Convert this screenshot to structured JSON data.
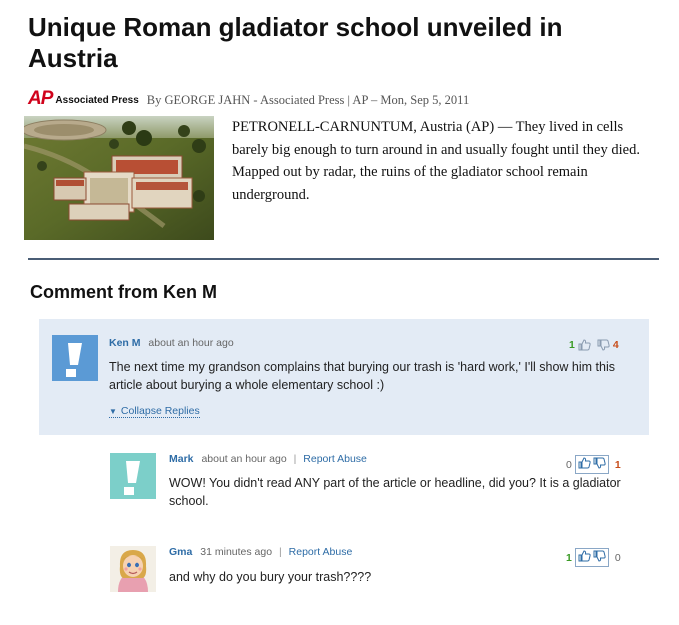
{
  "article": {
    "headline": "Unique Roman gladiator school unveiled in Austria",
    "logo_mark": "AP",
    "logo_text": "Associated Press",
    "byline": "By GEORGE JAHN - Associated Press | AP – Mon, Sep 5, 2011",
    "paragraph1": "PETRONELL-CARNUNTUM, Austria (AP) — They lived in cells barely big enough to turn around in and usually fought until they died.",
    "paragraph2": "Mapped out by radar, the ruins of the gladiator school remain underground."
  },
  "comments_section": {
    "title": "Comment from Ken M"
  },
  "comments": [
    {
      "author": "Ken M",
      "time": "about an hour ago",
      "text": "The next time my grandson complains that burying our trash is 'hard work,' I'll show him this article about burying a whole elementary school :)",
      "thumbs_up": "1",
      "thumbs_down": "4",
      "collapse_label": "Collapse Replies",
      "avatar_color": "#5b9ad5"
    },
    {
      "author": "Mark",
      "time": "about an hour ago",
      "report_label": "Report Abuse",
      "text": "WOW! You didn't read ANY part of the article or headline, did you? It is a gladiator school.",
      "thumbs_up": "0",
      "thumbs_down": "1",
      "avatar_color": "#7ccfc9"
    },
    {
      "author": "Gma",
      "time": "31 minutes ago",
      "report_label": "Report Abuse",
      "text": "and why do you bury your trash????",
      "thumbs_up": "1",
      "thumbs_down": "0"
    }
  ],
  "colors": {
    "link": "#2e6ca6",
    "upvote": "#3a9a25",
    "downvote": "#c84d1a",
    "highlight_bg": "#e3ebf5",
    "divider": "#4a5d75",
    "ap_red": "#d0021b"
  }
}
